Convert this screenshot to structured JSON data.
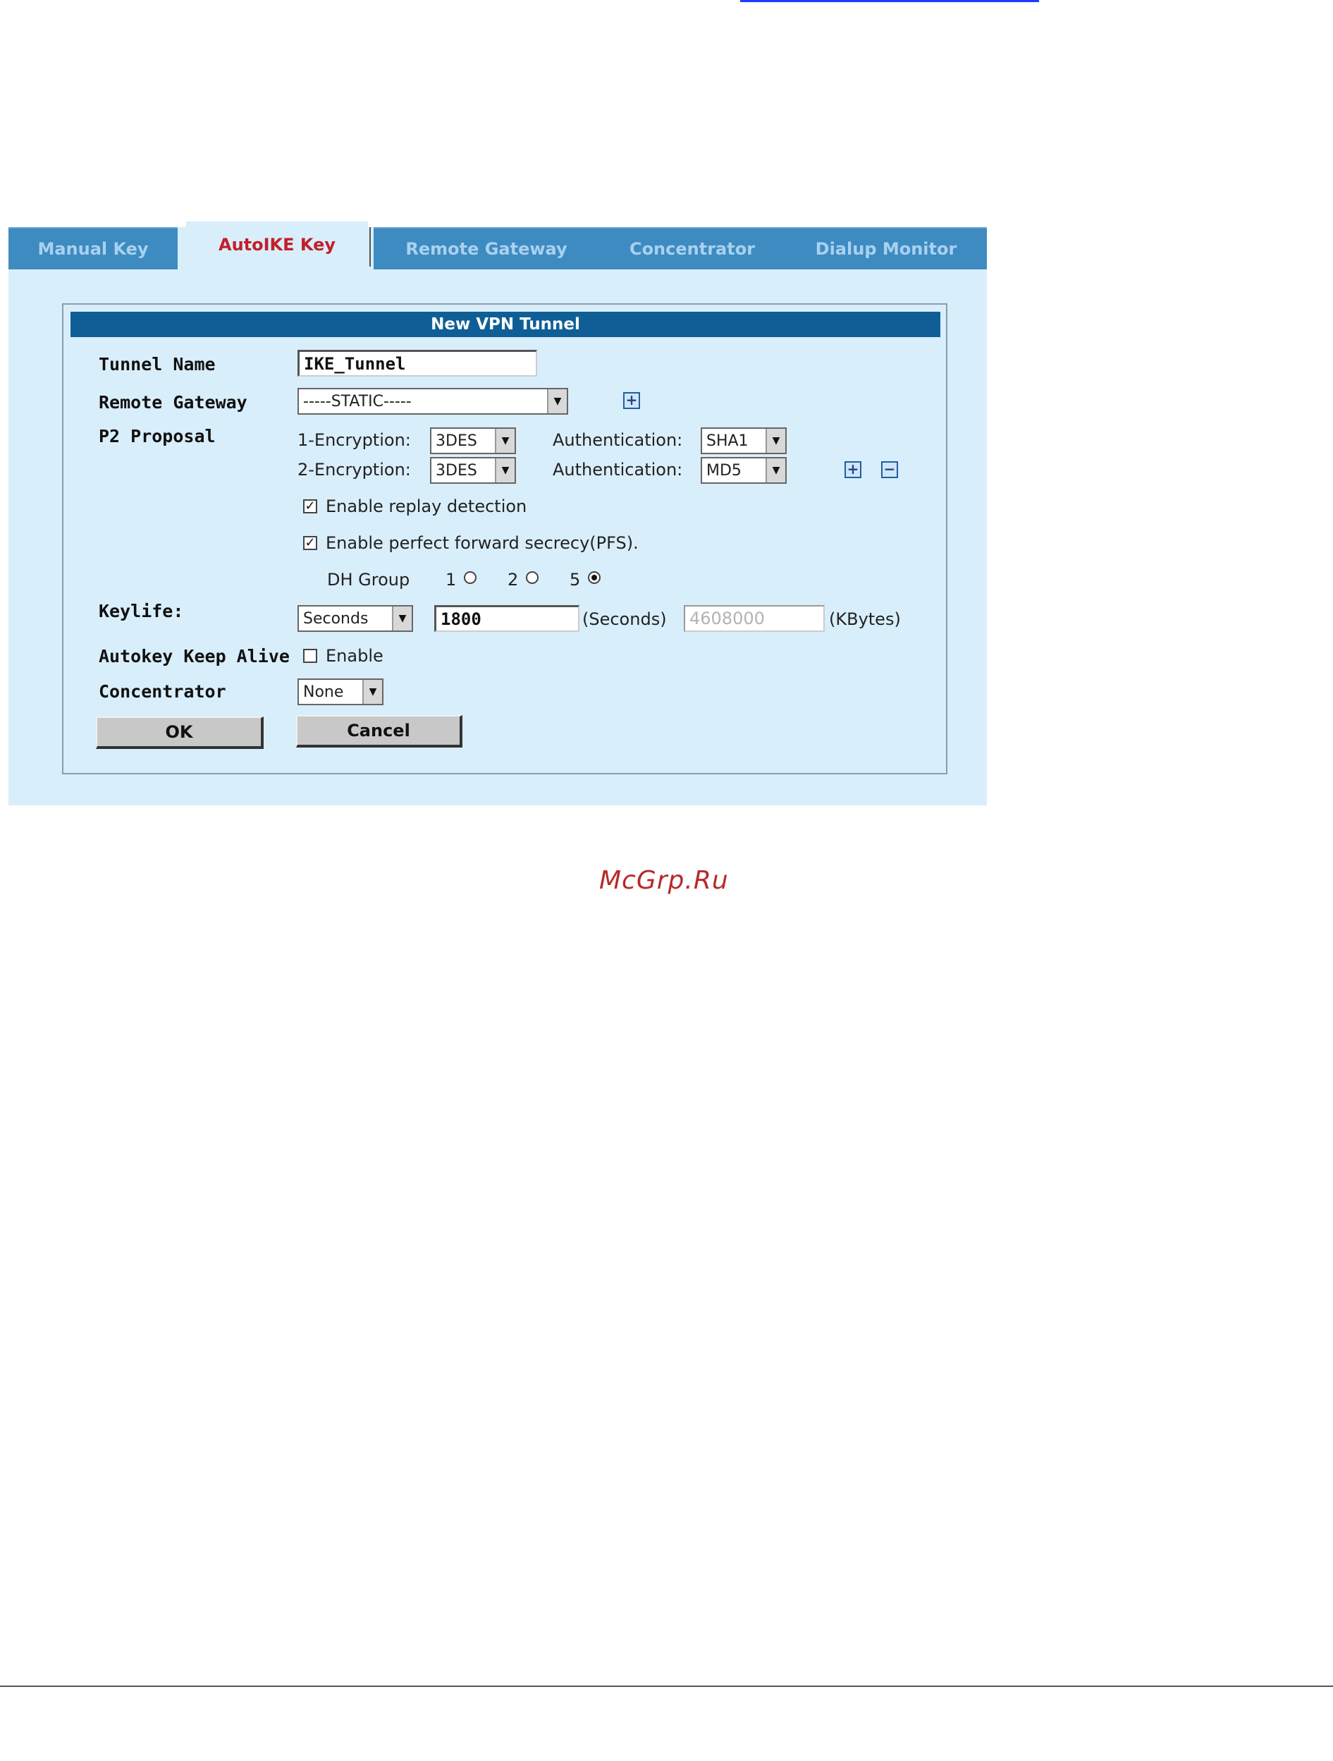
{
  "tabs": [
    {
      "label": "Manual Key",
      "active": false
    },
    {
      "label": "AutoIKE Key",
      "active": true
    },
    {
      "label": "Remote Gateway",
      "active": false
    },
    {
      "label": "Concentrator",
      "active": false
    },
    {
      "label": "Dialup Monitor",
      "active": false
    }
  ],
  "form": {
    "title": "New VPN Tunnel",
    "tunnel_name_label": "Tunnel Name",
    "tunnel_name_value": "IKE_Tunnel",
    "remote_gateway_label": "Remote Gateway",
    "remote_gateway_value": "-----STATIC-----",
    "p2_label": "P2 Proposal",
    "enc1_label": "1-Encryption:",
    "enc1_value": "3DES",
    "auth1_label": "Authentication:",
    "auth1_value": "SHA1",
    "enc2_label": "2-Encryption:",
    "enc2_value": "3DES",
    "auth2_label": "Authentication:",
    "auth2_value": "MD5",
    "replay_label": "Enable replay detection",
    "replay_checked": true,
    "pfs_label": "Enable perfect forward secrecy(PFS).",
    "pfs_checked": true,
    "dh_label": "DH Group",
    "dh_options": [
      "1",
      "2",
      "5"
    ],
    "dh_selected": "5",
    "keylife_label": "Keylife:",
    "keylife_unit": "Seconds",
    "keylife_seconds": "1800",
    "seconds_unit_label": "(Seconds)",
    "keylife_kbytes": "4608000",
    "kbytes_unit_label": "(KBytes)",
    "keepalive_label": "Autokey Keep Alive",
    "keepalive_enable_label": "Enable",
    "keepalive_checked": false,
    "concentrator_label": "Concentrator",
    "concentrator_value": "None",
    "ok_label": "OK",
    "cancel_label": "Cancel"
  },
  "watermark": "McGrp.Ru",
  "icons": {
    "add": "plus-box-icon",
    "remove": "minus-box-icon",
    "dropdown": "chevron-down-icon"
  },
  "colors": {
    "tab_inactive": "#3e8bc2",
    "tab_active_text": "#c0202a",
    "panel_bg": "#d9eefb",
    "title_bar": "#0f5f96",
    "watermark": "#b62a2a"
  }
}
